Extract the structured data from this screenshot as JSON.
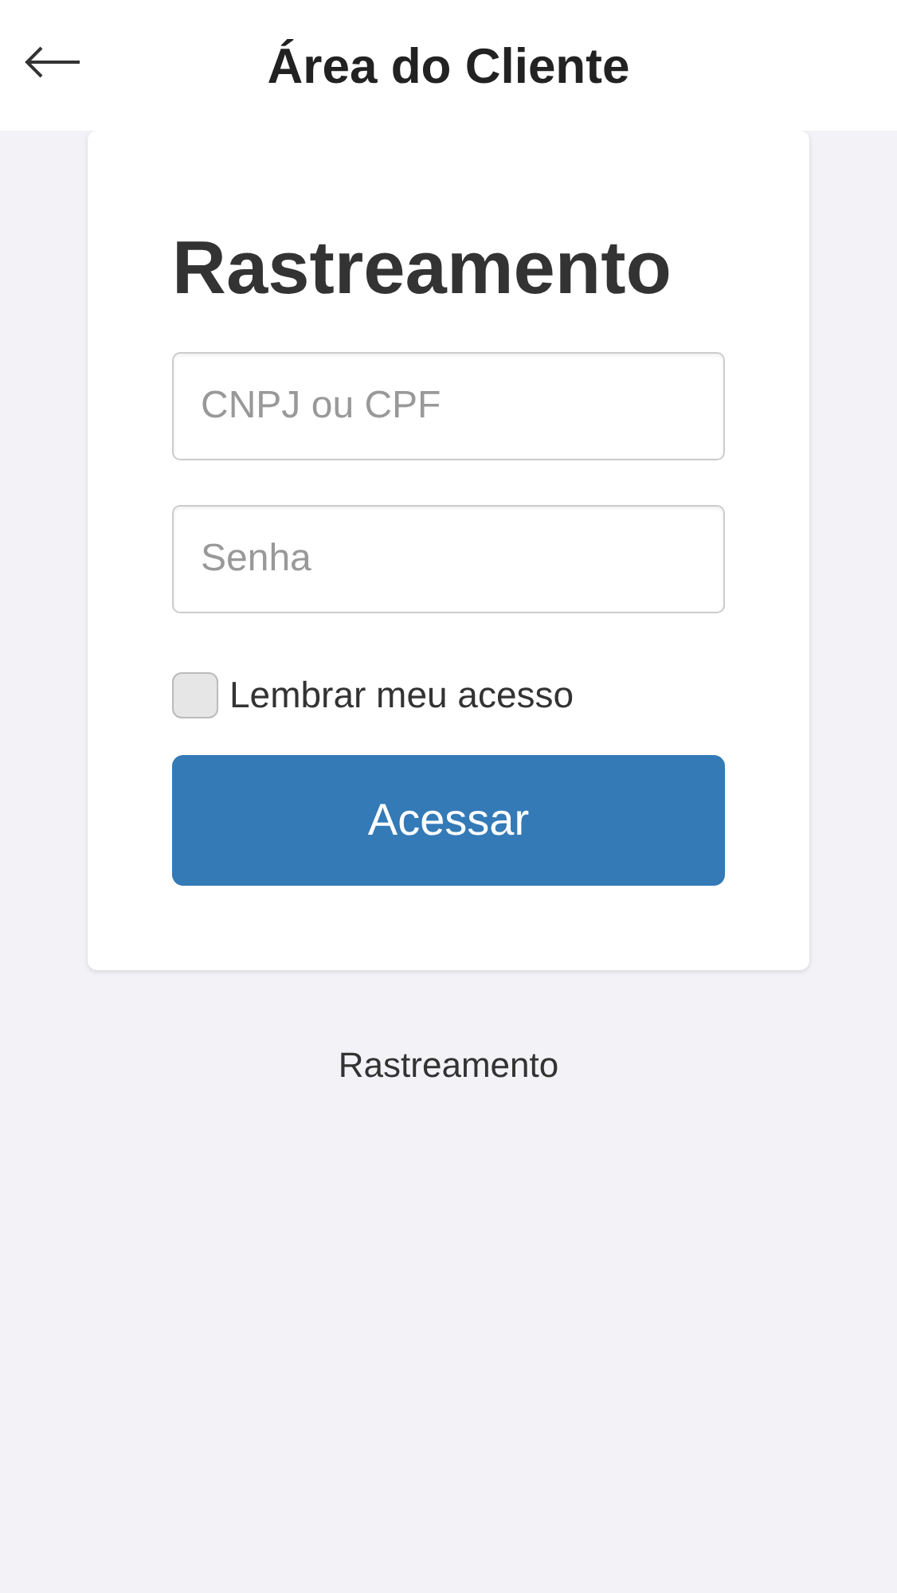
{
  "header": {
    "title": "Área do Cliente"
  },
  "login_card": {
    "title": "Rastreamento",
    "fields": [
      {
        "placeholder": "CNPJ ou CPF"
      },
      {
        "placeholder": "Senha"
      }
    ],
    "remember": {
      "label": "Lembrar meu acesso",
      "checked": false
    },
    "submit_button": "Acessar"
  },
  "footer_link": "Rastreamento"
}
